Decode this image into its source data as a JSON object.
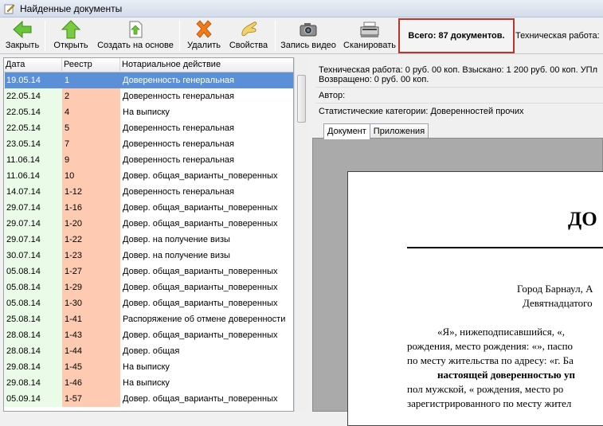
{
  "window": {
    "title": "Найденные документы"
  },
  "toolbar": {
    "close_label": "Закрыть",
    "open_label": "Открыть",
    "create_label": "Создать на основе",
    "delete_label": "Удалить",
    "props_label": "Свойства",
    "video_label": "Запись видео",
    "scan_label": "Сканировать",
    "total_text": "Всего: 87 документов.",
    "tech_text": "Техническая работа:"
  },
  "grid": {
    "headers": [
      "Дата",
      "Реестр",
      "Нотариальное действие"
    ],
    "rows": [
      [
        "19.05.14",
        "1",
        "Доверенность генеральная"
      ],
      [
        "22.05.14",
        "2",
        "Доверенность генеральная"
      ],
      [
        "22.05.14",
        "4",
        "На выписку"
      ],
      [
        "22.05.14",
        "5",
        "Доверенность генеральная"
      ],
      [
        "23.05.14",
        "7",
        "Доверенность генеральная"
      ],
      [
        "11.06.14",
        "9",
        "Доверенность генеральная"
      ],
      [
        "11.06.14",
        "10",
        "Довер. общая_варианты_поверенных"
      ],
      [
        "14.07.14",
        "1-12",
        "Доверенность генеральная"
      ],
      [
        "29.07.14",
        "1-16",
        "Довер. общая_варианты_поверенных"
      ],
      [
        "29.07.14",
        "1-20",
        "Довер. общая_варианты_поверенных"
      ],
      [
        "29.07.14",
        "1-22",
        "Довер. на получение визы"
      ],
      [
        "30.07.14",
        "1-23",
        "Довер. на получение визы"
      ],
      [
        "05.08.14",
        "1-27",
        "Довер. общая_варианты_поверенных"
      ],
      [
        "05.08.14",
        "1-29",
        "Довер. общая_варианты_поверенных"
      ],
      [
        "05.08.14",
        "1-30",
        "Довер. общая_варианты_поверенных"
      ],
      [
        "25.08.14",
        "1-41",
        "Распоряжение об отмене доверенности"
      ],
      [
        "28.08.14",
        "1-43",
        "Довер. общая_варианты_поверенных"
      ],
      [
        "28.08.14",
        "1-44",
        "Довер. общая"
      ],
      [
        "29.08.14",
        "1-45",
        "На выписку"
      ],
      [
        "29.08.14",
        "1-46",
        "На выписку"
      ],
      [
        "05.09.14",
        "1-57",
        "Довер. общая_варианты_поверенных"
      ]
    ]
  },
  "details": {
    "line1": "Техническая работа: 0 руб. 00 коп. Взыскано: 1 200 руб. 00 коп. УПл",
    "line2": "Возвращено: 0 руб. 00 коп.",
    "author": "Автор:",
    "category": "Статистические категории: Доверенностей прочих",
    "tabs": [
      "Документ",
      "Приложения"
    ]
  },
  "document": {
    "heading": "ДО",
    "city": "Город Барнаул, А",
    "date": "Девятнадцатого",
    "p1": "«Я», нижеподписавшийся, «,",
    "p2": "рождения, место рождения: «», паспо",
    "p3": "по месту жительства по адресу: «г. Ба",
    "p4": "настоящей доверенностью уп",
    "p5": "пол мужской, « рождения, место ро",
    "p6": "зарегистрированного по месту жител"
  }
}
